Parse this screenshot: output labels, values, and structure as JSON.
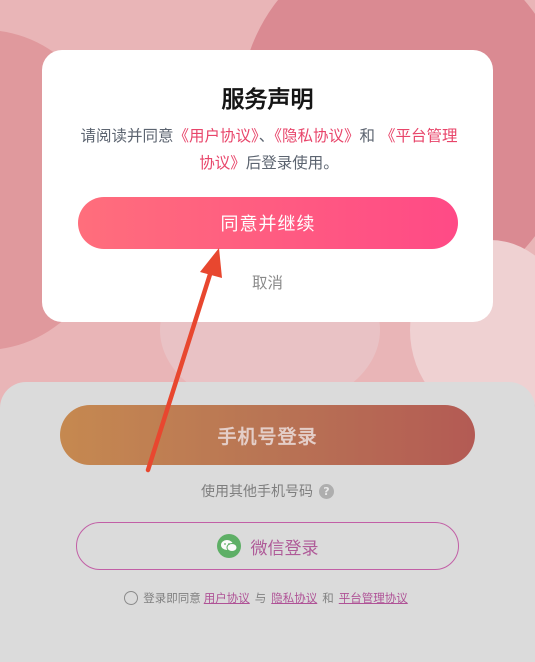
{
  "modal": {
    "title": "服务声明",
    "body_prefix": "请阅读并同意",
    "link_user": "《用户协议》",
    "sep1": "、",
    "link_privacy": "《隐私协议》",
    "and": "和 ",
    "link_platform": "《平台管理协议》",
    "body_suffix": "后登录使用。",
    "agree_label": "同意并继续",
    "cancel_label": "取消"
  },
  "login": {
    "phone_login_label": "手机号登录",
    "other_phone_label": "使用其他手机号码",
    "wechat_login_label": "微信登录",
    "agreement": {
      "prefix": "登录即同意",
      "link_user": "用户协议",
      "with": "与",
      "link_privacy": "隐私协议",
      "and": "和",
      "link_platform": "平台管理协议"
    }
  },
  "colors": {
    "accent_gradient_start": "#ff6e7c",
    "accent_gradient_end": "#ff4a86",
    "link": "#e8456a",
    "wechat_green": "#2f9b3a",
    "arrow": "#e8472f"
  }
}
